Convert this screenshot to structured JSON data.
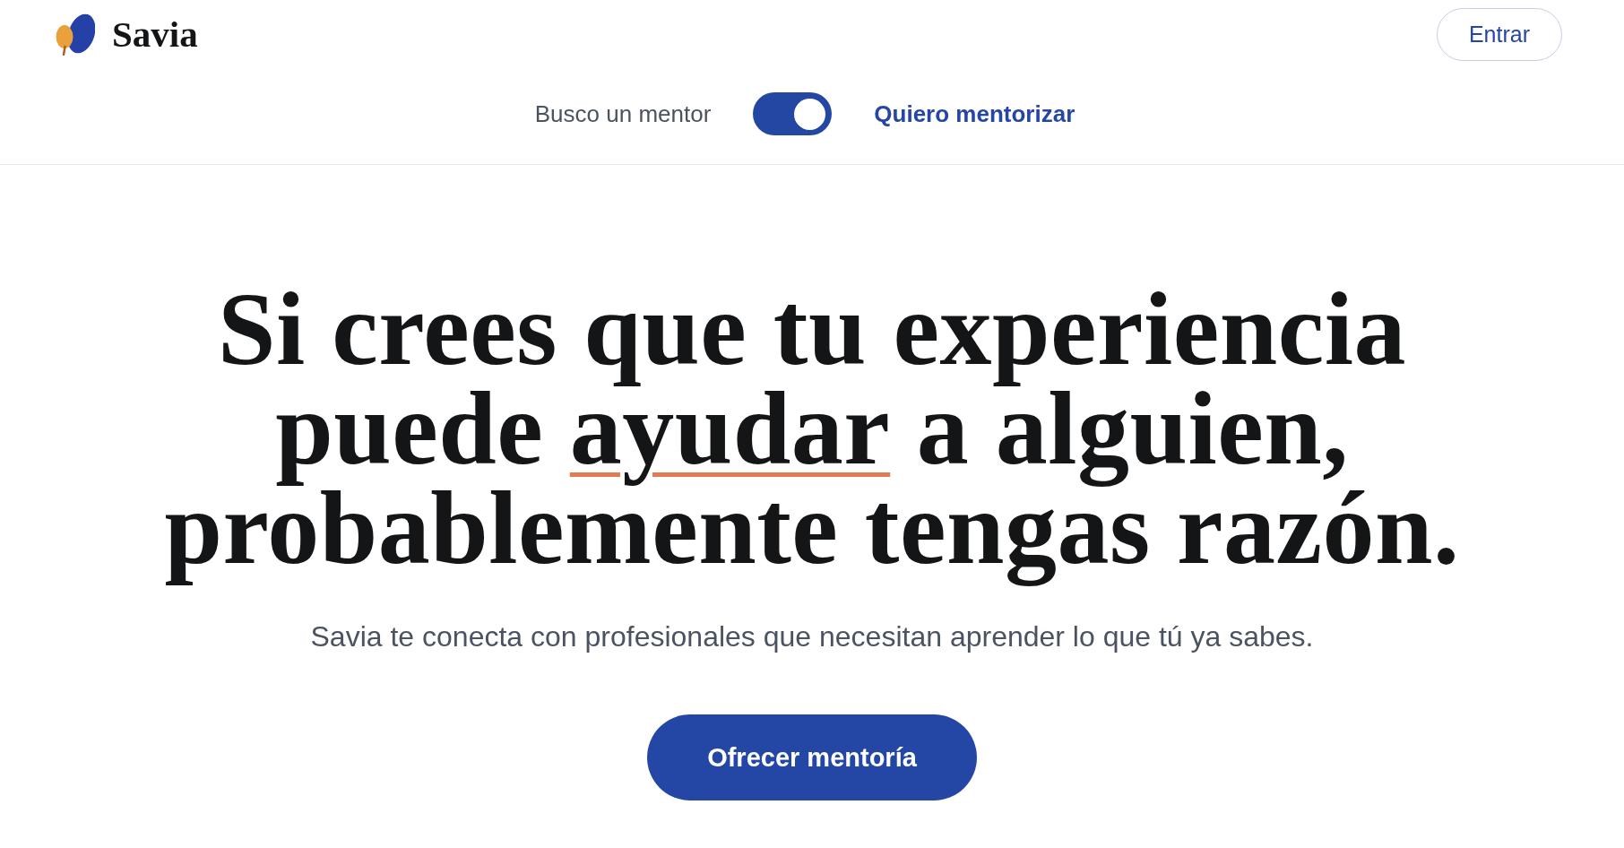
{
  "header": {
    "brand": "Savia",
    "login_button": "Entrar"
  },
  "role_switch": {
    "options": [
      {
        "label": "Busco un mentor",
        "selected": false
      },
      {
        "label": "Quiero mentorizar",
        "selected": true
      }
    ],
    "on": true
  },
  "hero": {
    "headline": {
      "lines": [
        {
          "segments": [
            {
              "text": "Si crees que tu experiencia",
              "underlined": false
            }
          ]
        },
        {
          "segments": [
            {
              "text": "puede ",
              "underlined": false
            },
            {
              "text": "ayudar",
              "underlined": true
            },
            {
              "text": " a alguien,",
              "underlined": false
            }
          ]
        },
        {
          "segments": [
            {
              "text": "probablemente tengas razón.",
              "underlined": false
            }
          ]
        }
      ]
    },
    "subtitle": "Savia te conecta con profesionales que necesitan aprender lo que tú ya sabes.",
    "cta_button": "Ofrecer mentoría"
  }
}
